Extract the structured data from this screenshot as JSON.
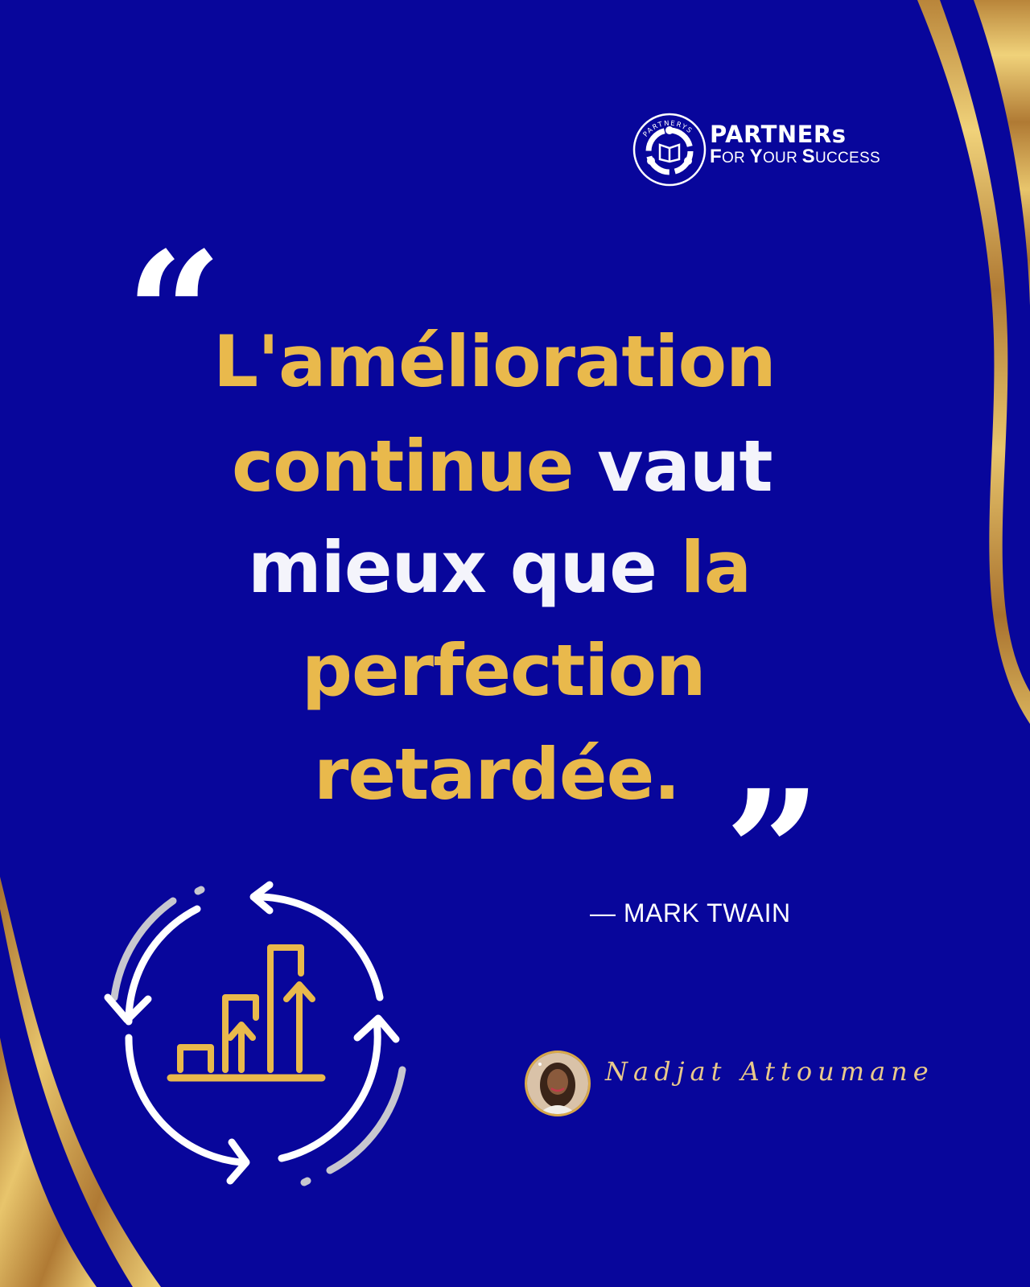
{
  "brand": {
    "emblem_text": "PARTNERYS",
    "name": "PARTNERs",
    "tagline_parts": [
      {
        "cap": "F",
        "rest": "OR "
      },
      {
        "cap": "Y",
        "rest": "OUR "
      },
      {
        "cap": "S",
        "rest": "UCCESS"
      }
    ]
  },
  "quote": {
    "open_mark": "“",
    "close_mark": "”",
    "line1": "L'amélioration",
    "line2_gold": "continue",
    "line2_white": "vaut",
    "line3_white": "mieux que",
    "line3_gold": "la",
    "line4": "perfection",
    "line5": "retardée.",
    "author": "— MARK TWAIN"
  },
  "signature": {
    "name": "Nadjat Attoumane"
  },
  "icons": {
    "logo": "partners-emblem-icon",
    "illustration": "continuous-improvement-cycle-icon",
    "avatar": "person-avatar"
  },
  "colors": {
    "background": "#08069b",
    "gold": "#e9b94c",
    "white": "#f4f4fb",
    "ribbon_gold": "#c9953c"
  }
}
